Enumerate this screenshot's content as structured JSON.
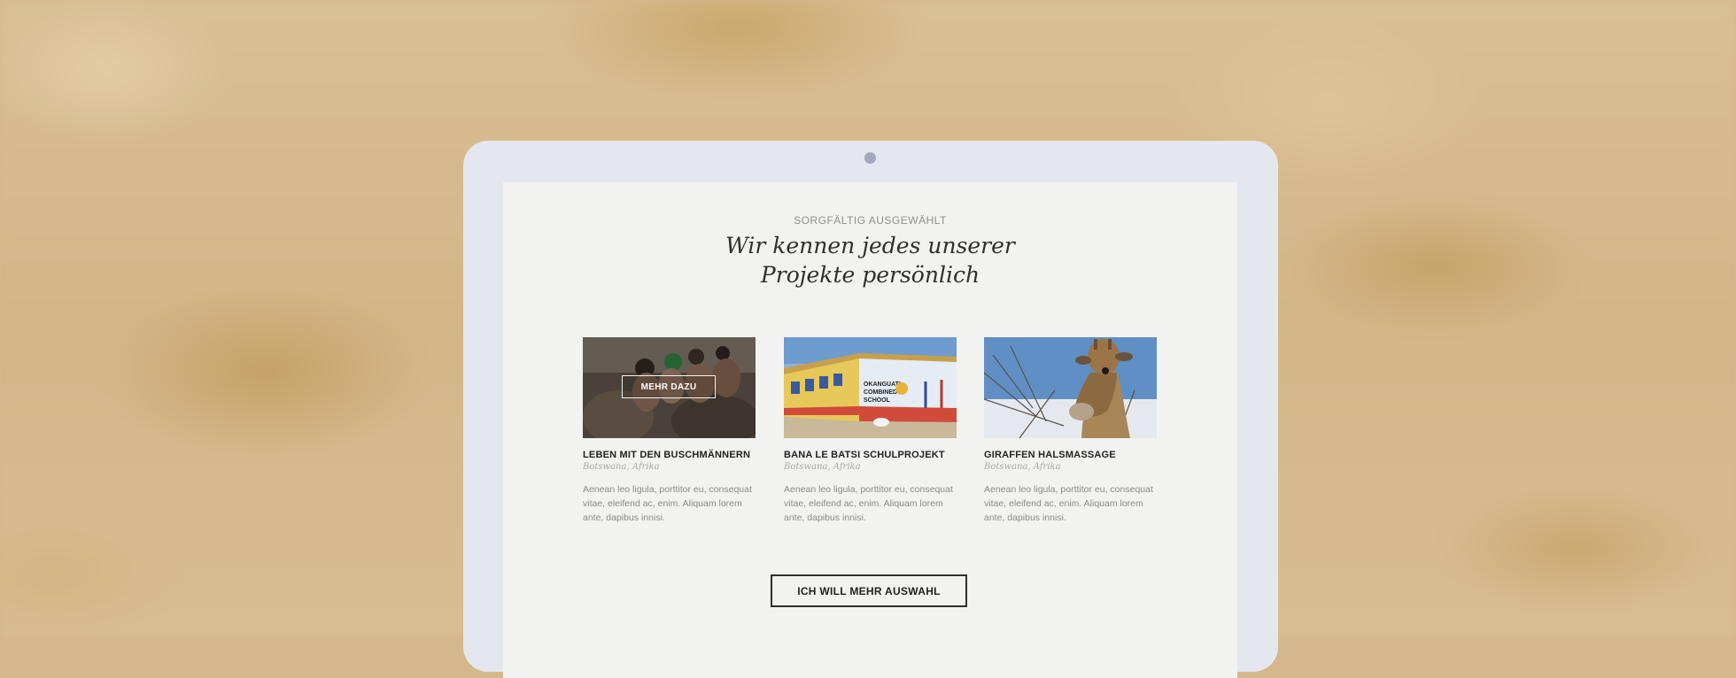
{
  "section": {
    "eyebrow": "SORGFÄLTIG AUSGEWÄHLT",
    "headline_line1": "Wir kennen jedes unserer",
    "headline_line2": "Projekte persönlich"
  },
  "projects": [
    {
      "title": "LEBEN MIT DEN BUSCHMÄNNERN",
      "location": "Botswana, Afrika",
      "description": "Aenean leo ligula, porttitor eu, consequat vitae, eleifend ac, enim. Aliquam lorem ante, dapibus innisi.",
      "overlay_button": "MEHR DAZU"
    },
    {
      "title": "BANA LE BATSI SCHULPROJEKT",
      "location": "Botswana, Afrika",
      "description": "Aenean leo ligula, porttitor eu, consequat vitae, eleifend ac, enim. Aliquam lorem ante, dapibus innisi.",
      "sign_text": "OKANGUATI COMBINED SCHOOL"
    },
    {
      "title": "GIRAFFEN HALSMASSAGE",
      "location": "Botswana, Afrika",
      "description": "Aenean leo ligula, porttitor eu, consequat vitae, eleifend ac, enim. Aliquam lorem ante, dapibus innisi."
    }
  ],
  "cta_label": "ICH WILL MEHR AUSWAHL",
  "colors": {
    "background": "#d4b88c",
    "laptop_frame": "#e4e7ee",
    "screen": "#f2f2f0",
    "text_dark": "#222222",
    "text_muted": "#8a8a8a"
  }
}
